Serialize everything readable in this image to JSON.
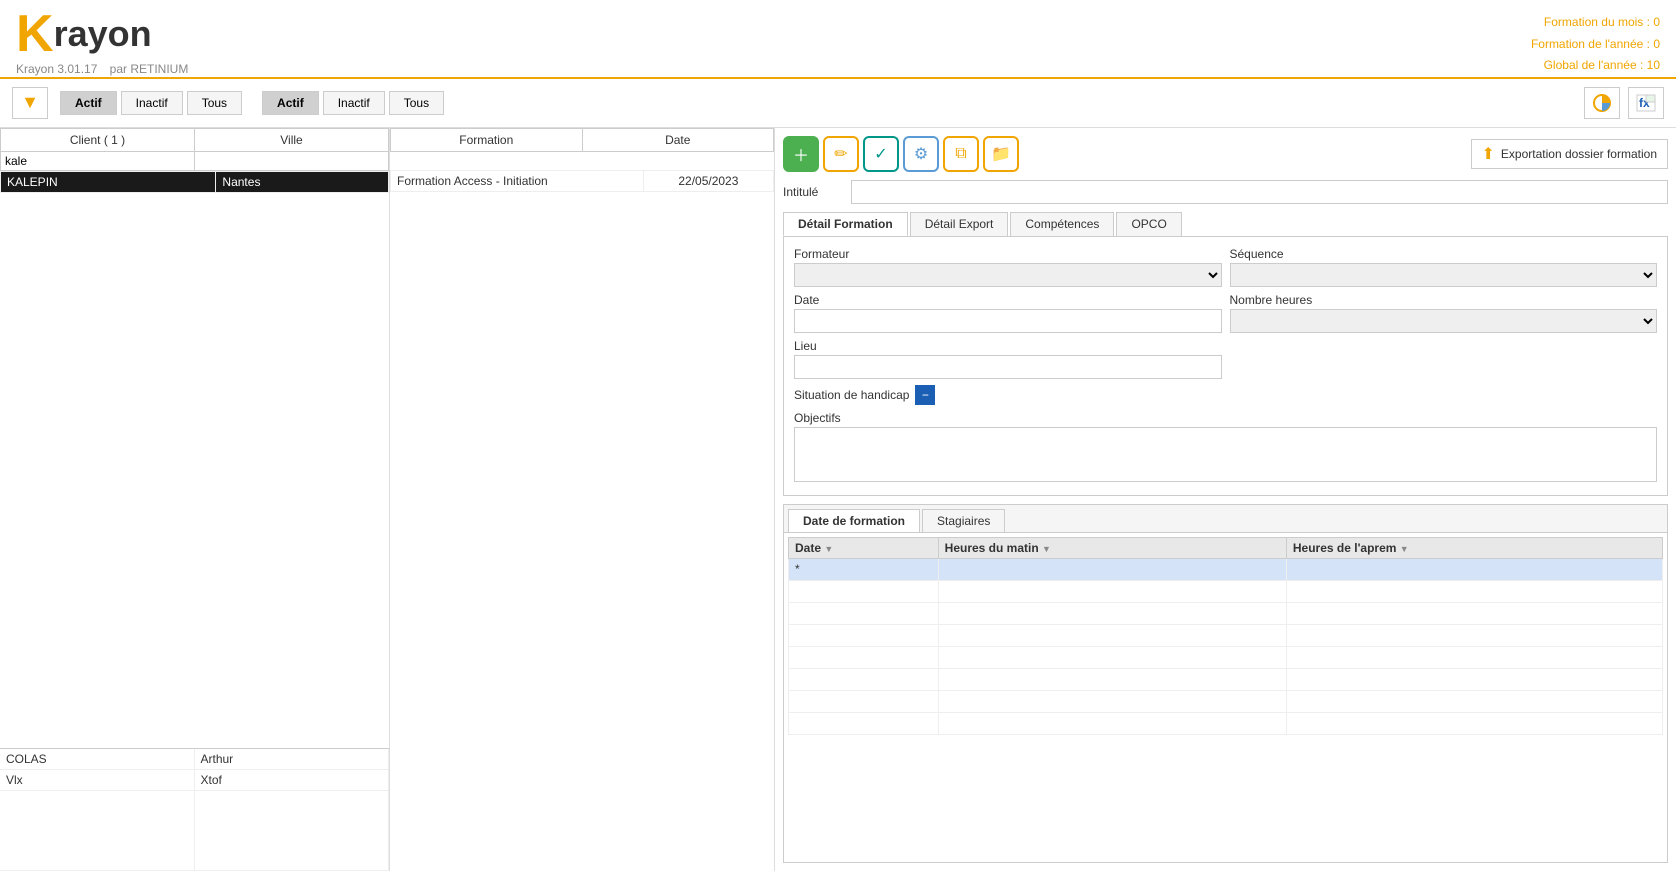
{
  "header": {
    "logo_k": "K",
    "logo_rayon": "rayon",
    "version": "Krayon 3.01.17",
    "par": "par RETINIUM",
    "stat1_label": "Formation du mois :",
    "stat1_value": "0",
    "stat2_label": "Formation de l'année :",
    "stat2_value": "0",
    "stat3_label": "Global de l'année :",
    "stat3_value": "10"
  },
  "toolbar": {
    "group1": {
      "actif": "Actif",
      "inactif": "Inactif",
      "tous": "Tous"
    },
    "group2": {
      "actif": "Actif",
      "inactif": "Inactif",
      "tous": "Tous"
    }
  },
  "left_panel": {
    "col1_header": "Client ( 1 )",
    "col2_header": "Ville",
    "search_value": "kale",
    "rows": [
      {
        "col1": "KALEPIN",
        "col2": "Nantes",
        "selected": true
      }
    ],
    "bottom_rows": [
      {
        "col1": "COLAS",
        "col2": "Arthur"
      },
      {
        "col1": "Vlx",
        "col2": "Xtof"
      }
    ]
  },
  "mid_panel": {
    "col1_header": "Formation",
    "col2_header": "Date",
    "search_value": "",
    "rows": [
      {
        "col1": "Formation Access - Initiation",
        "col2": "22/05/2023"
      }
    ]
  },
  "right_panel": {
    "export_btn_label": "Exportation dossier formation",
    "intitule_label": "Intitulé",
    "tabs": [
      "Détail Formation",
      "Détail Export",
      "Compétences",
      "OPCO"
    ],
    "active_tab": "Détail Formation",
    "formateur_label": "Formateur",
    "date_label": "Date",
    "lieu_label": "Lieu",
    "handicap_label": "Situation de handicap",
    "sequence_label": "Séquence",
    "nombre_label": "Nombre heures",
    "objectifs_label": "Objectifs",
    "bottom_tabs": [
      "Date de formation",
      "Stagiaires"
    ],
    "active_bottom_tab": "Date de formation",
    "grid_cols": [
      "Date",
      "Heures du matin",
      "Heures de l'aprem"
    ]
  }
}
